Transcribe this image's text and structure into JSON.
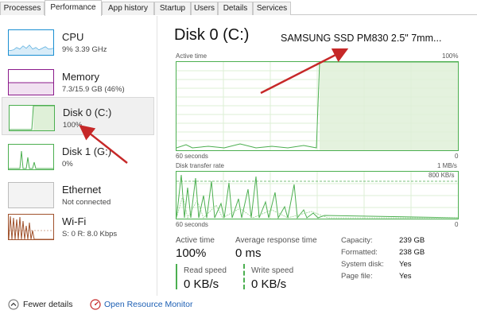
{
  "tabs": [
    {
      "label": "Processes"
    },
    {
      "label": "Performance"
    },
    {
      "label": "App history"
    },
    {
      "label": "Startup"
    },
    {
      "label": "Users"
    },
    {
      "label": "Details"
    },
    {
      "label": "Services"
    }
  ],
  "sidebar": {
    "items": [
      {
        "title": "CPU",
        "sub": "9%  3.39 GHz",
        "color": "#1a8fd2"
      },
      {
        "title": "Memory",
        "sub": "7.3/15.9 GB (46%)",
        "color": "#8b1a8b"
      },
      {
        "title": "Disk 0 (C:)",
        "sub": "100%",
        "color": "#4caf50"
      },
      {
        "title": "Disk 1 (G:)",
        "sub": "0%",
        "color": "#4caf50"
      },
      {
        "title": "Ethernet",
        "sub": "Not connected",
        "color": "#999999"
      },
      {
        "title": "Wi-Fi",
        "sub": "S: 0  R: 8.0 Kbps",
        "color": "#a0522d"
      }
    ]
  },
  "main": {
    "title": "Disk 0 (C:)",
    "model": "SAMSUNG SSD PM830 2.5\" 7mm...",
    "active_graph": {
      "label": "Active time",
      "max_label": "100%",
      "time_label": "60 seconds",
      "min_label": "0"
    },
    "transfer_graph": {
      "label": "Disk transfer rate",
      "max_label": "1 MB/s",
      "mid_label": "800 KB/s",
      "time_label": "60 seconds",
      "min_label": "0"
    },
    "stats": {
      "active_time_label": "Active time",
      "active_time_value": "100%",
      "avg_response_label": "Average response time",
      "avg_response_value": "0 ms",
      "read_label": "Read speed",
      "read_value": "0 KB/s",
      "write_label": "Write speed",
      "write_value": "0 KB/s"
    },
    "properties": [
      {
        "label": "Capacity:",
        "value": "239 GB"
      },
      {
        "label": "Formatted:",
        "value": "238 GB"
      },
      {
        "label": "System disk:",
        "value": "Yes"
      },
      {
        "label": "Page file:",
        "value": "Yes"
      }
    ]
  },
  "footer": {
    "fewer_details": "Fewer details",
    "open_resource_monitor": "Open Resource Monitor"
  },
  "colors": {
    "disk_green": "#4caf50",
    "annotation_red": "#c62828",
    "link_blue": "#1c5fb4"
  }
}
